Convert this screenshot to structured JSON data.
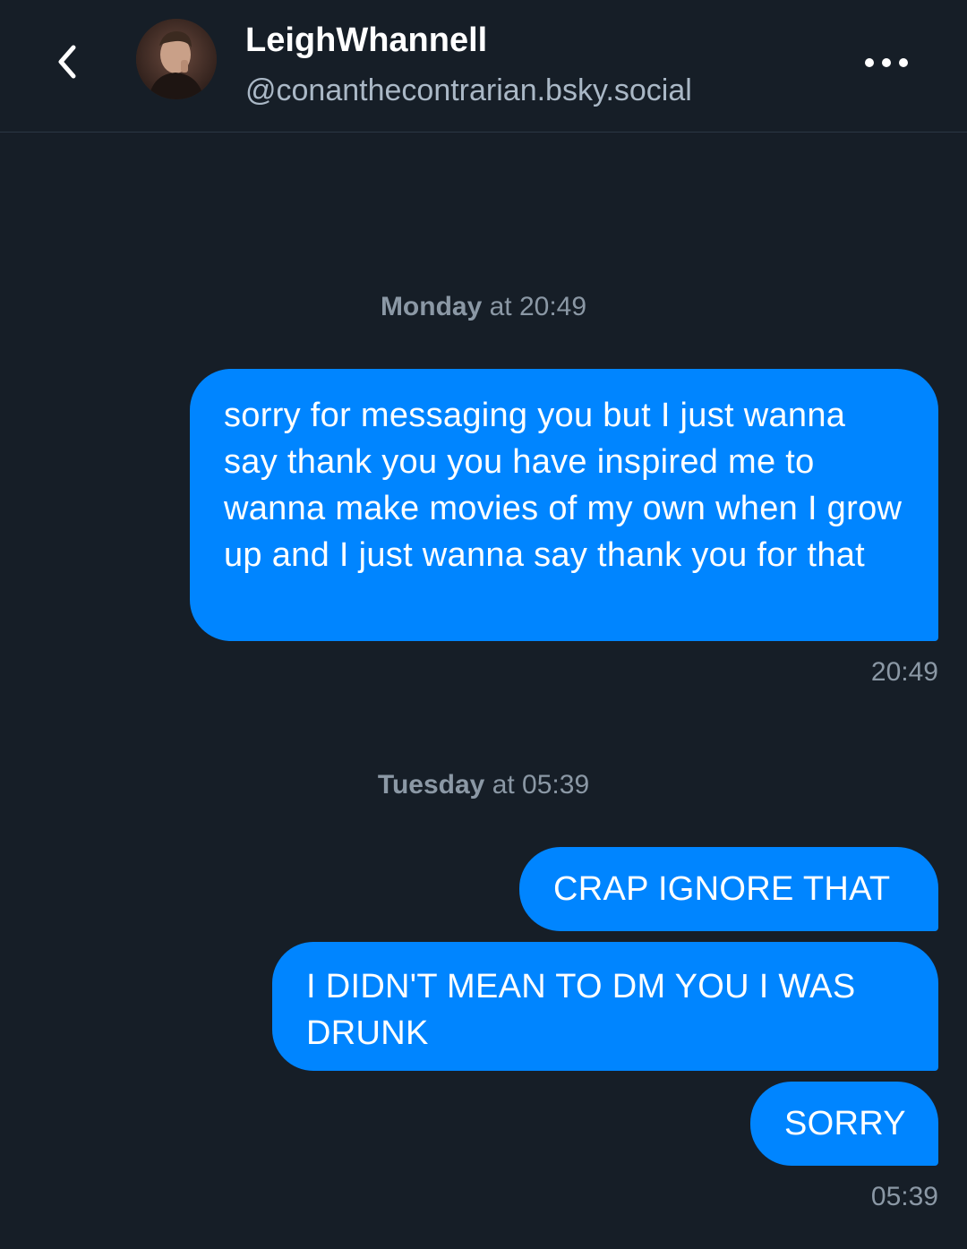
{
  "header": {
    "back_icon": "chevron-left-icon",
    "display_name": "LeighWhannell",
    "handle": "@conanthecontrarian.bsky.social",
    "more_icon": "more-horizontal-icon"
  },
  "conversation": [
    {
      "day": "Monday",
      "time_suffix": " at 20:49",
      "messages": [
        {
          "text": "sorry for messaging you but I just wanna say thank you you have inspired me to wanna make movies of my own when I grow up and I just wanna say thank you for that"
        }
      ],
      "timestamp": "20:49"
    },
    {
      "day": "Tuesday",
      "time_suffix": " at 05:39",
      "messages": [
        {
          "text": "CRAP IGNORE THAT"
        },
        {
          "text": "I DIDN'T MEAN TO DM YOU I WAS DRUNK"
        },
        {
          "text": "SORRY"
        }
      ],
      "timestamp": "05:39"
    }
  ],
  "colors": {
    "background": "#161e27",
    "bubble": "#0085ff",
    "secondary_text": "#8b98a5"
  }
}
